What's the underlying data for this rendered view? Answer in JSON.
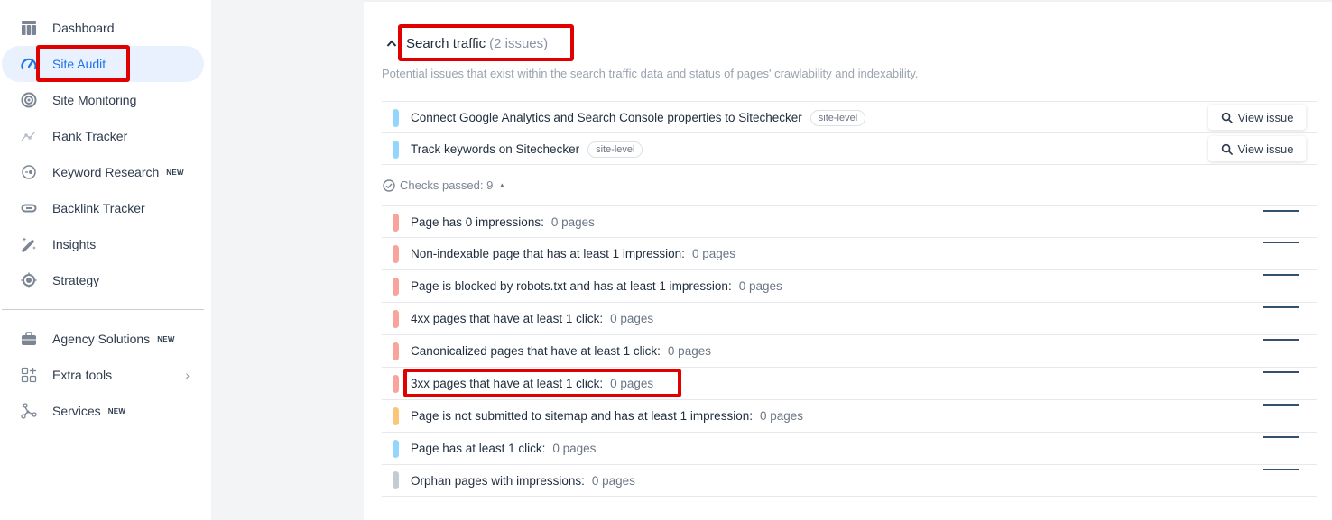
{
  "sidebar": {
    "items": [
      {
        "label": "Dashboard",
        "icon": "dashboard-icon",
        "active": false,
        "badge": null
      },
      {
        "label": "Site Audit",
        "icon": "gauge-icon",
        "active": true,
        "badge": null
      },
      {
        "label": "Site Monitoring",
        "icon": "radar-icon",
        "active": false,
        "badge": null
      },
      {
        "label": "Rank Tracker",
        "icon": "trend-line-icon",
        "active": false,
        "badge": null
      },
      {
        "label": "Keyword Research",
        "icon": "keyword-icon",
        "active": false,
        "badge": "NEW"
      },
      {
        "label": "Backlink Tracker",
        "icon": "link-icon",
        "active": false,
        "badge": null
      },
      {
        "label": "Insights",
        "icon": "magic-wand-icon",
        "active": false,
        "badge": null
      },
      {
        "label": "Strategy",
        "icon": "target-icon",
        "active": false,
        "badge": null
      }
    ],
    "secondary_items": [
      {
        "label": "Agency Solutions",
        "icon": "briefcase-icon",
        "badge": "NEW"
      },
      {
        "label": "Extra tools",
        "icon": "grid-plus-icon",
        "chevron": "›"
      },
      {
        "label": "Services",
        "icon": "nodes-icon",
        "badge": "NEW"
      }
    ]
  },
  "section": {
    "caret": "^",
    "title": "Search traffic",
    "count": "(2 issues)",
    "description": "Potential issues that exist within the search traffic data and status of pages' crawlability and indexability."
  },
  "issues": [
    {
      "label": "Connect Google Analytics and Search Console properties to Sitechecker",
      "tag": "site-level",
      "severity": "info",
      "button": "View issue"
    },
    {
      "label": "Track keywords on Sitechecker",
      "tag": "site-level",
      "severity": "info",
      "button": "View issue"
    }
  ],
  "checks_passed": {
    "label": "Checks passed: 9",
    "toggle": "▲"
  },
  "passed_checks": [
    {
      "label": "Page has 0 impressions:",
      "count": "0 pages",
      "severity": "error"
    },
    {
      "label": "Non-indexable page that has at least 1 impression:",
      "count": "0 pages",
      "severity": "error"
    },
    {
      "label": "Page is blocked by robots.txt and has at least 1 impression:",
      "count": "0 pages",
      "severity": "error"
    },
    {
      "label": "4xx pages that have at least 1 click:",
      "count": "0 pages",
      "severity": "error"
    },
    {
      "label": "Canonicalized pages that have at least 1 click:",
      "count": "0 pages",
      "severity": "error"
    },
    {
      "label": "3xx pages that have at least 1 click:",
      "count": "0 pages",
      "severity": "error"
    },
    {
      "label": "Page is not submitted to sitemap and has at least 1 impression:",
      "count": "0 pages",
      "severity": "warning"
    },
    {
      "label": "Page has at least 1 click:",
      "count": "0 pages",
      "severity": "info"
    },
    {
      "label": "Orphan pages with impressions:",
      "count": "0 pages",
      "severity": "notice"
    }
  ],
  "colors": {
    "error": "#f8a39c",
    "warning": "#fbc67a",
    "info": "#93d5fb",
    "notice": "#c5cbd3",
    "accent": "#1a73e8",
    "highlight": "#e00000"
  }
}
